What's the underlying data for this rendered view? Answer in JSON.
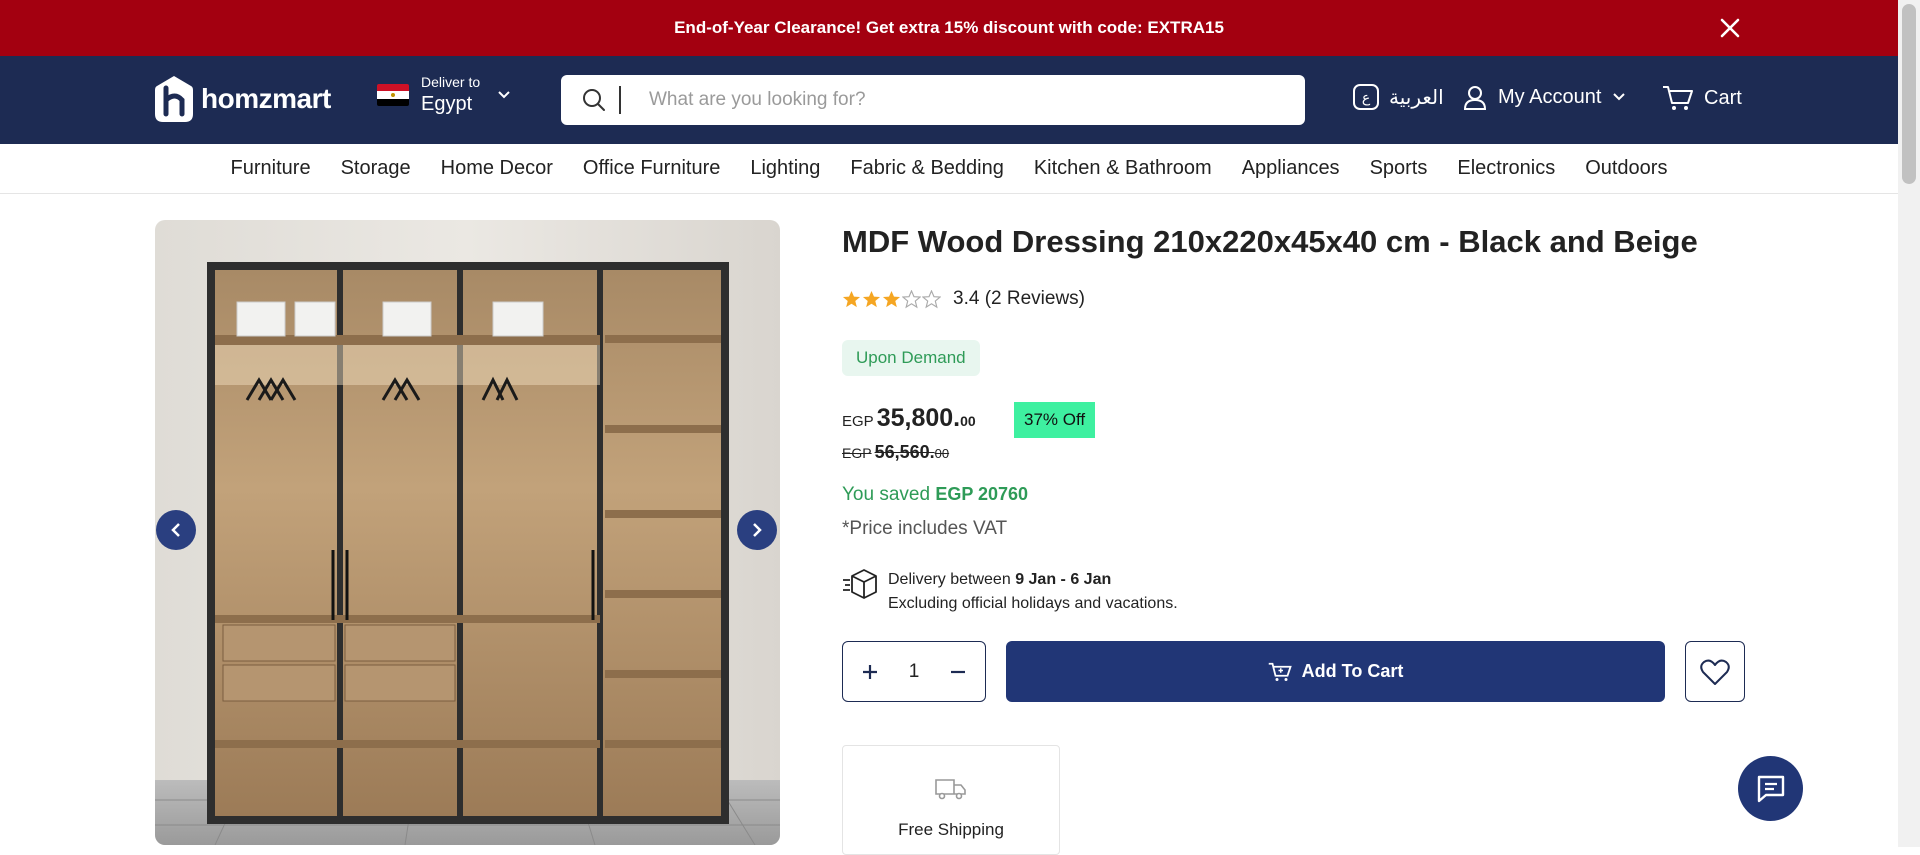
{
  "promo": {
    "text": "End-of-Year Clearance! Get extra 15% discount with code: EXTRA15"
  },
  "header": {
    "logo_text": "homzmart",
    "deliver_label": "Deliver to",
    "country": "Egypt",
    "search_placeholder": "What are you looking for?",
    "language": "العربية",
    "language_badge": "ع",
    "account": "My Account",
    "cart": "Cart"
  },
  "nav": [
    "Furniture",
    "Storage",
    "Home Decor",
    "Office Furniture",
    "Lighting",
    "Fabric & Bedding",
    "Kitchen & Bathroom",
    "Appliances",
    "Sports",
    "Electronics",
    "Outdoors"
  ],
  "product": {
    "title": "MDF Wood Dressing 210x220x45x40 cm - Black and Beige",
    "rating_value": 3.4,
    "rating_text": "3.4 (2 Reviews)",
    "availability": "Upon Demand",
    "currency": "EGP",
    "price_int": "35,800.",
    "price_dec": "00",
    "discount": "37% Off",
    "old_price_int": "56,560.",
    "old_price_dec": "00",
    "saved_label": "You saved",
    "saved_amount": "EGP 20760",
    "vat_note": "*Price includes VAT",
    "delivery_prefix": "Delivery between",
    "delivery_range": "9 Jan - 6 Jan",
    "delivery_note": "Excluding official holidays and vacations.",
    "quantity": "1",
    "add_to_cart": "Add To Cart",
    "feature_free_shipping": "Free Shipping"
  },
  "colors": {
    "promo": "#a30010",
    "header": "#1d2b53",
    "primary": "#213676",
    "success": "#2e9b57",
    "discount": "#3ef0a0",
    "star": "#f5a623"
  },
  "icons": [
    "close-icon",
    "search-icon",
    "chevron-down-icon",
    "user-icon",
    "cart-icon",
    "star-icon",
    "chevron-left-icon",
    "chevron-right-icon",
    "delivery-box-icon",
    "plus-icon",
    "minus-icon",
    "heart-icon",
    "truck-icon",
    "chat-icon"
  ]
}
